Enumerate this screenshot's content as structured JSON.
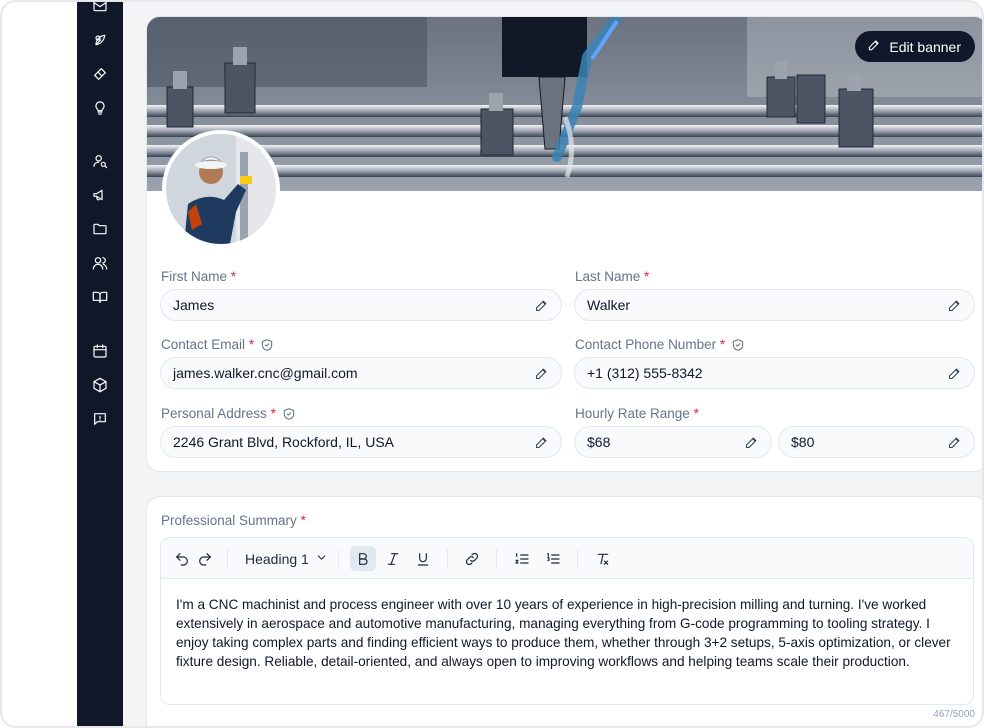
{
  "banner": {
    "edit_label": "Edit banner"
  },
  "profile": {
    "first_name": {
      "label": "First Name",
      "value": "James"
    },
    "last_name": {
      "label": "Last Name",
      "value": "Walker"
    },
    "contact_email": {
      "label": "Contact Email",
      "value": "james.walker.cnc@gmail.com"
    },
    "contact_phone": {
      "label": "Contact Phone Number",
      "value": "+1 (312) 555-8342"
    },
    "personal_address": {
      "label": "Personal Address",
      "value": "2246 Grant Blvd, Rockford, IL, USA"
    },
    "hourly_rate": {
      "label": "Hourly Rate Range",
      "min": "$68",
      "max": "$80"
    },
    "required_marker": "*"
  },
  "summary": {
    "label": "Professional Summary",
    "heading_option": "Heading 1",
    "text": "I'm a CNC machinist and process engineer with over 10 years of experience in high-precision milling and turning. I've worked extensively in aerospace and automotive manufacturing, managing everything from G-code programming to tooling strategy. I enjoy taking complex parts and finding efficient ways to produce them, whether through 3+2 setups, 5-axis optimization, or clever fixture design. Reliable, detail-oriented, and always open to improving workflows and helping teams scale their production.",
    "char_count": "467/5000"
  },
  "sidebar_icons": [
    "mail-icon",
    "leaf-icon",
    "ticket-icon",
    "lightbulb-icon",
    "user-search-icon",
    "megaphone-icon",
    "folder-icon",
    "users-icon",
    "book-icon",
    "calendar-icon",
    "box-icon",
    "message-icon"
  ],
  "colors": {
    "sidebar": "#0f1729",
    "accent_dark": "#0f172a",
    "required": "#e11d48",
    "label": "#64748b"
  }
}
